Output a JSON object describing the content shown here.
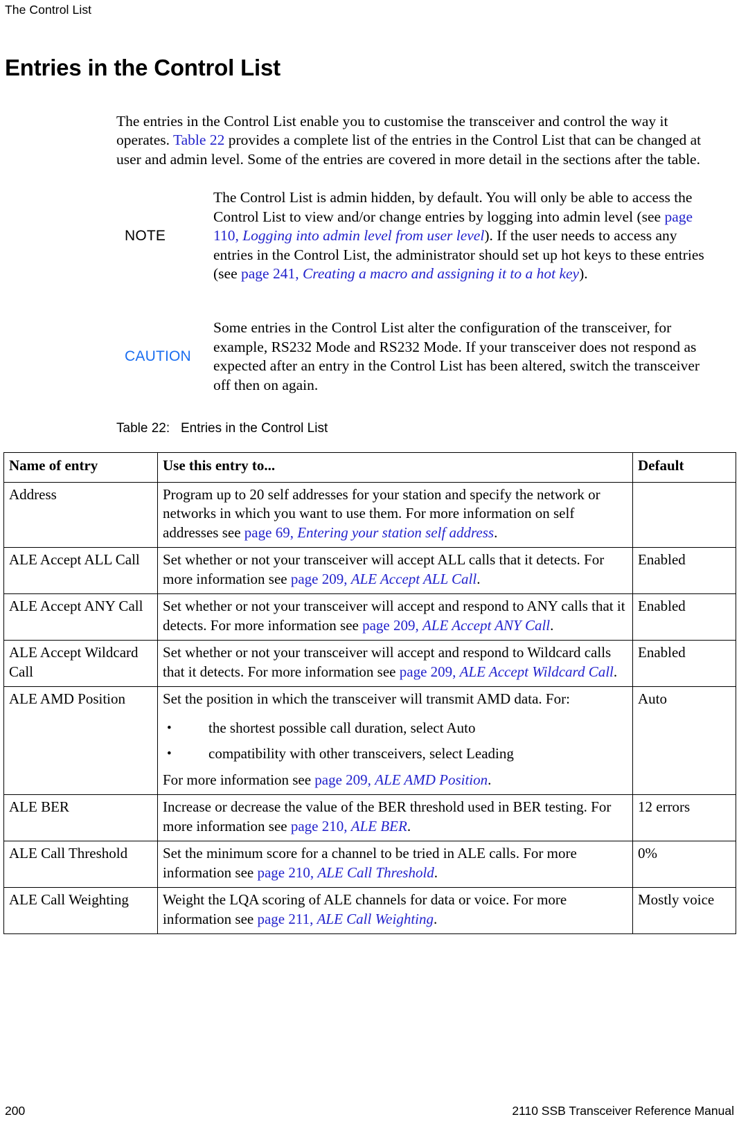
{
  "header": {
    "running_title": "The Control List"
  },
  "page_title": "Entries in the Control List",
  "intro": {
    "part1": "The entries in the Control List enable you to customise the transceiver and control the way it operates. ",
    "link_table": "Table 22",
    "part2": " provides a complete list of the entries in the Control List that can be changed at user and admin level. Some of the entries are covered in more detail in the sections after the table."
  },
  "note": {
    "label": "NOTE",
    "t1": "The Control List is admin hidden, by default. You will only be able to access the Control List to view and/or change entries by logging into admin level (see ",
    "link1_page": "page 110, ",
    "link1_title": "Logging into admin level from user level",
    "t2": "). If the user needs to access any entries in the Control List, the administrator should set up hot keys to these entries (see ",
    "link2_page": "page 241, ",
    "link2_title": "Creating a macro and assigning it to a hot key",
    "t3": ")."
  },
  "caution": {
    "label": "CAUTION",
    "text": "Some entries in the Control List alter the configuration of the transceiver, for example, RS232 Mode and RS232 Mode. If your transceiver does not respond as expected after an entry in the Control List has been altered, switch the transceiver off then on again."
  },
  "table": {
    "caption_number": "Table 22:",
    "caption_title": "Entries in the Control List",
    "headers": {
      "name": "Name of entry",
      "use": "Use this entry to...",
      "default": "Default"
    },
    "rows": [
      {
        "name": "Address",
        "use_t1": "Program up to 20 self addresses for your station and specify the network or networks in which you want to use them. For more information on self addresses see ",
        "use_link_page": "page 69, ",
        "use_link_title": "Entering your station self address",
        "use_t2": ".",
        "default": ""
      },
      {
        "name": "ALE Accept ALL Call",
        "use_t1": "Set whether or not your transceiver will accept ALL calls that it detects. For more information see ",
        "use_link_page": "page 209, ",
        "use_link_title": "ALE Accept ALL Call",
        "use_t2": ".",
        "default": "Enabled"
      },
      {
        "name": "ALE Accept ANY Call",
        "use_t1": "Set whether or not your transceiver will accept and respond to ANY calls that it detects. For more information see ",
        "use_link_page": "page 209, ",
        "use_link_title": "ALE Accept ANY Call",
        "use_t2": ".",
        "default": "Enabled"
      },
      {
        "name": "ALE Accept Wildcard Call",
        "use_t1": "Set whether or not your transceiver will accept and respond to Wildcard calls that it detects. For more information see ",
        "use_link_page": "page 209, ",
        "use_link_title": "ALE Accept Wildcard Call",
        "use_t2": ".",
        "default": "Enabled"
      },
      {
        "name": "ALE AMD Position",
        "use_t1": "Set the position in which the transceiver will transmit AMD data. For:",
        "bullets": [
          "the shortest possible call duration, select Auto",
          "compatibility with other transceivers, select Leading"
        ],
        "use_t2": "For more information see ",
        "use_link_page": "page 209, ",
        "use_link_title": "ALE AMD Position",
        "use_t3": ".",
        "default": "Auto"
      },
      {
        "name": "ALE BER",
        "use_t1": "Increase or decrease the value of the BER threshold used in BER testing. For more information see ",
        "use_link_page": "page 210, ",
        "use_link_title": "ALE BER",
        "use_t2": ".",
        "default": "12 errors"
      },
      {
        "name": "ALE Call Threshold",
        "use_t1": "Set the minimum score for a channel to be tried in ALE calls. For more information see ",
        "use_link_page": "page 210, ",
        "use_link_title": "ALE Call Threshold",
        "use_t2": ".",
        "default": "0%"
      },
      {
        "name": "ALE Call Weighting",
        "use_t1": "Weight the LQA scoring of ALE channels for data or voice. For more information see ",
        "use_link_page": "page 211, ",
        "use_link_title": "ALE Call Weighting",
        "use_t2": ".",
        "default": "Mostly voice"
      }
    ]
  },
  "footer": {
    "page_number": "200",
    "manual_title": "2110 SSB Transceiver Reference Manual"
  },
  "colors": {
    "link": "#2222CC",
    "caution": "#1A6EF0",
    "text": "#000000",
    "background": "#FFFFFF"
  }
}
